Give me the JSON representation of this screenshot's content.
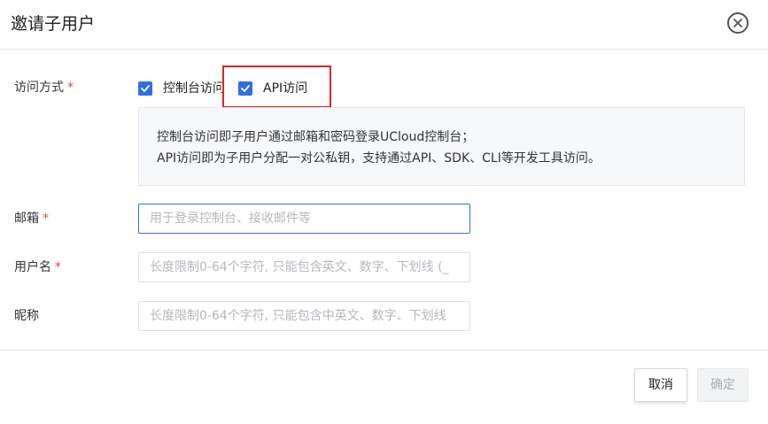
{
  "dialog": {
    "title": "邀请子用户",
    "close_icon": "close-circle-icon"
  },
  "access": {
    "label": "访问方式",
    "required_mark": "*",
    "options": [
      {
        "label": "控制台访问",
        "checked": true
      },
      {
        "label": "API访问",
        "checked": true
      }
    ],
    "info_lines": [
      "控制台访问即子用户通过邮箱和密码登录UCloud控制台；",
      "API访问即为子用户分配一对公私钥，支持通过API、SDK、CLI等开发工具访问。"
    ]
  },
  "email": {
    "label": "邮箱",
    "required_mark": "*",
    "placeholder": "用于登录控制台、接收邮件等",
    "value": ""
  },
  "username": {
    "label": "用户名",
    "required_mark": "*",
    "placeholder": "长度限制0-64个字符, 只能包含英文、数字、下划线 (_",
    "value": ""
  },
  "nickname": {
    "label": "昵称",
    "placeholder": "长度限制0-64个字符, 只能包含中英文、数字、下划线",
    "value": ""
  },
  "footer": {
    "cancel_label": "取消",
    "confirm_label": "确定"
  },
  "colors": {
    "accent": "#2f6fe4",
    "required": "#e5484d",
    "highlight_border": "#e02424"
  }
}
